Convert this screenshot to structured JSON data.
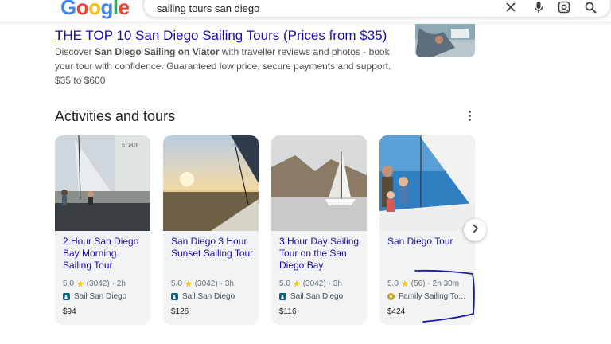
{
  "header": {
    "logo_text": "Google",
    "search_query": "sailing tours san diego",
    "icons": [
      "close-icon",
      "microphone-icon",
      "lens-icon",
      "search-icon"
    ]
  },
  "result": {
    "title": "THE TOP 10 San Diego Sailing Tours (Prices from $35)",
    "snippet_pre": "Discover ",
    "snippet_bold": "San Diego Sailing on Viator",
    "snippet_post": " with traveller reviews and photos - book your tour with confidence. Guaranteed low price, secure payments and support.",
    "price_range": "$35 to $600"
  },
  "activities": {
    "heading": "Activities and tours",
    "cards": [
      {
        "title": "2 Hour San Diego Bay Morning Sailing Tour",
        "rating": "5.0",
        "reviews": "(3042)",
        "duration": "· 2h",
        "provider": "Sail San Diego",
        "price": "$94"
      },
      {
        "title": "San Diego 3 Hour Sunset Sailing Tour",
        "rating": "5.0",
        "reviews": "(3042)",
        "duration": "· 3h",
        "provider": "Sail San Diego",
        "price": "$126"
      },
      {
        "title": "3 Hour Day Sailing Tour on the San Diego Bay",
        "rating": "5.0",
        "reviews": "(3042)",
        "duration": "· 3h",
        "provider": "Sail San Diego",
        "price": "$116"
      },
      {
        "title": "San Diego Tour",
        "rating": "5.0",
        "reviews": "(56)",
        "duration": "· 2h 30m",
        "provider": "Family Sailing To...",
        "price": "$424"
      }
    ]
  },
  "colors": {
    "link": "#1a0dab",
    "star": "#fbbc04",
    "annotation": "#1a1aa8"
  }
}
